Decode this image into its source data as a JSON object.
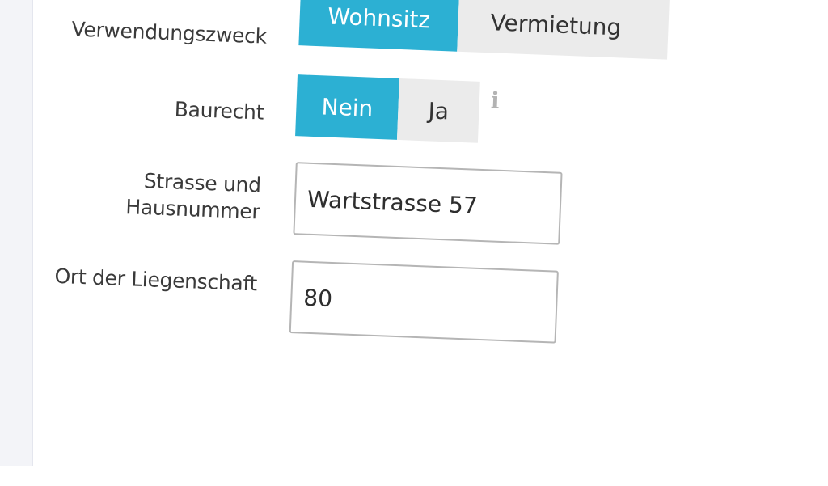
{
  "verwendungszweck": {
    "label": "Verwendungszweck",
    "options": [
      "Wohnsitz",
      "Vermietung"
    ],
    "selected": "Wohnsitz"
  },
  "baurecht": {
    "label": "Baurecht",
    "options": [
      "Nein",
      "Ja"
    ],
    "selected": "Nein",
    "info_icon": "info-icon"
  },
  "strasse": {
    "label_line1": "Strasse und",
    "label_line2": "Hausnummer",
    "value": "Wartstrasse 57"
  },
  "ort": {
    "label": "Ort der Liegenschaft",
    "value": "80"
  },
  "colors": {
    "accent": "#2cb0d3",
    "inactive_segment": "#ebebeb",
    "label_text": "#3a3a3a",
    "field_border": "#b5b5b5"
  }
}
